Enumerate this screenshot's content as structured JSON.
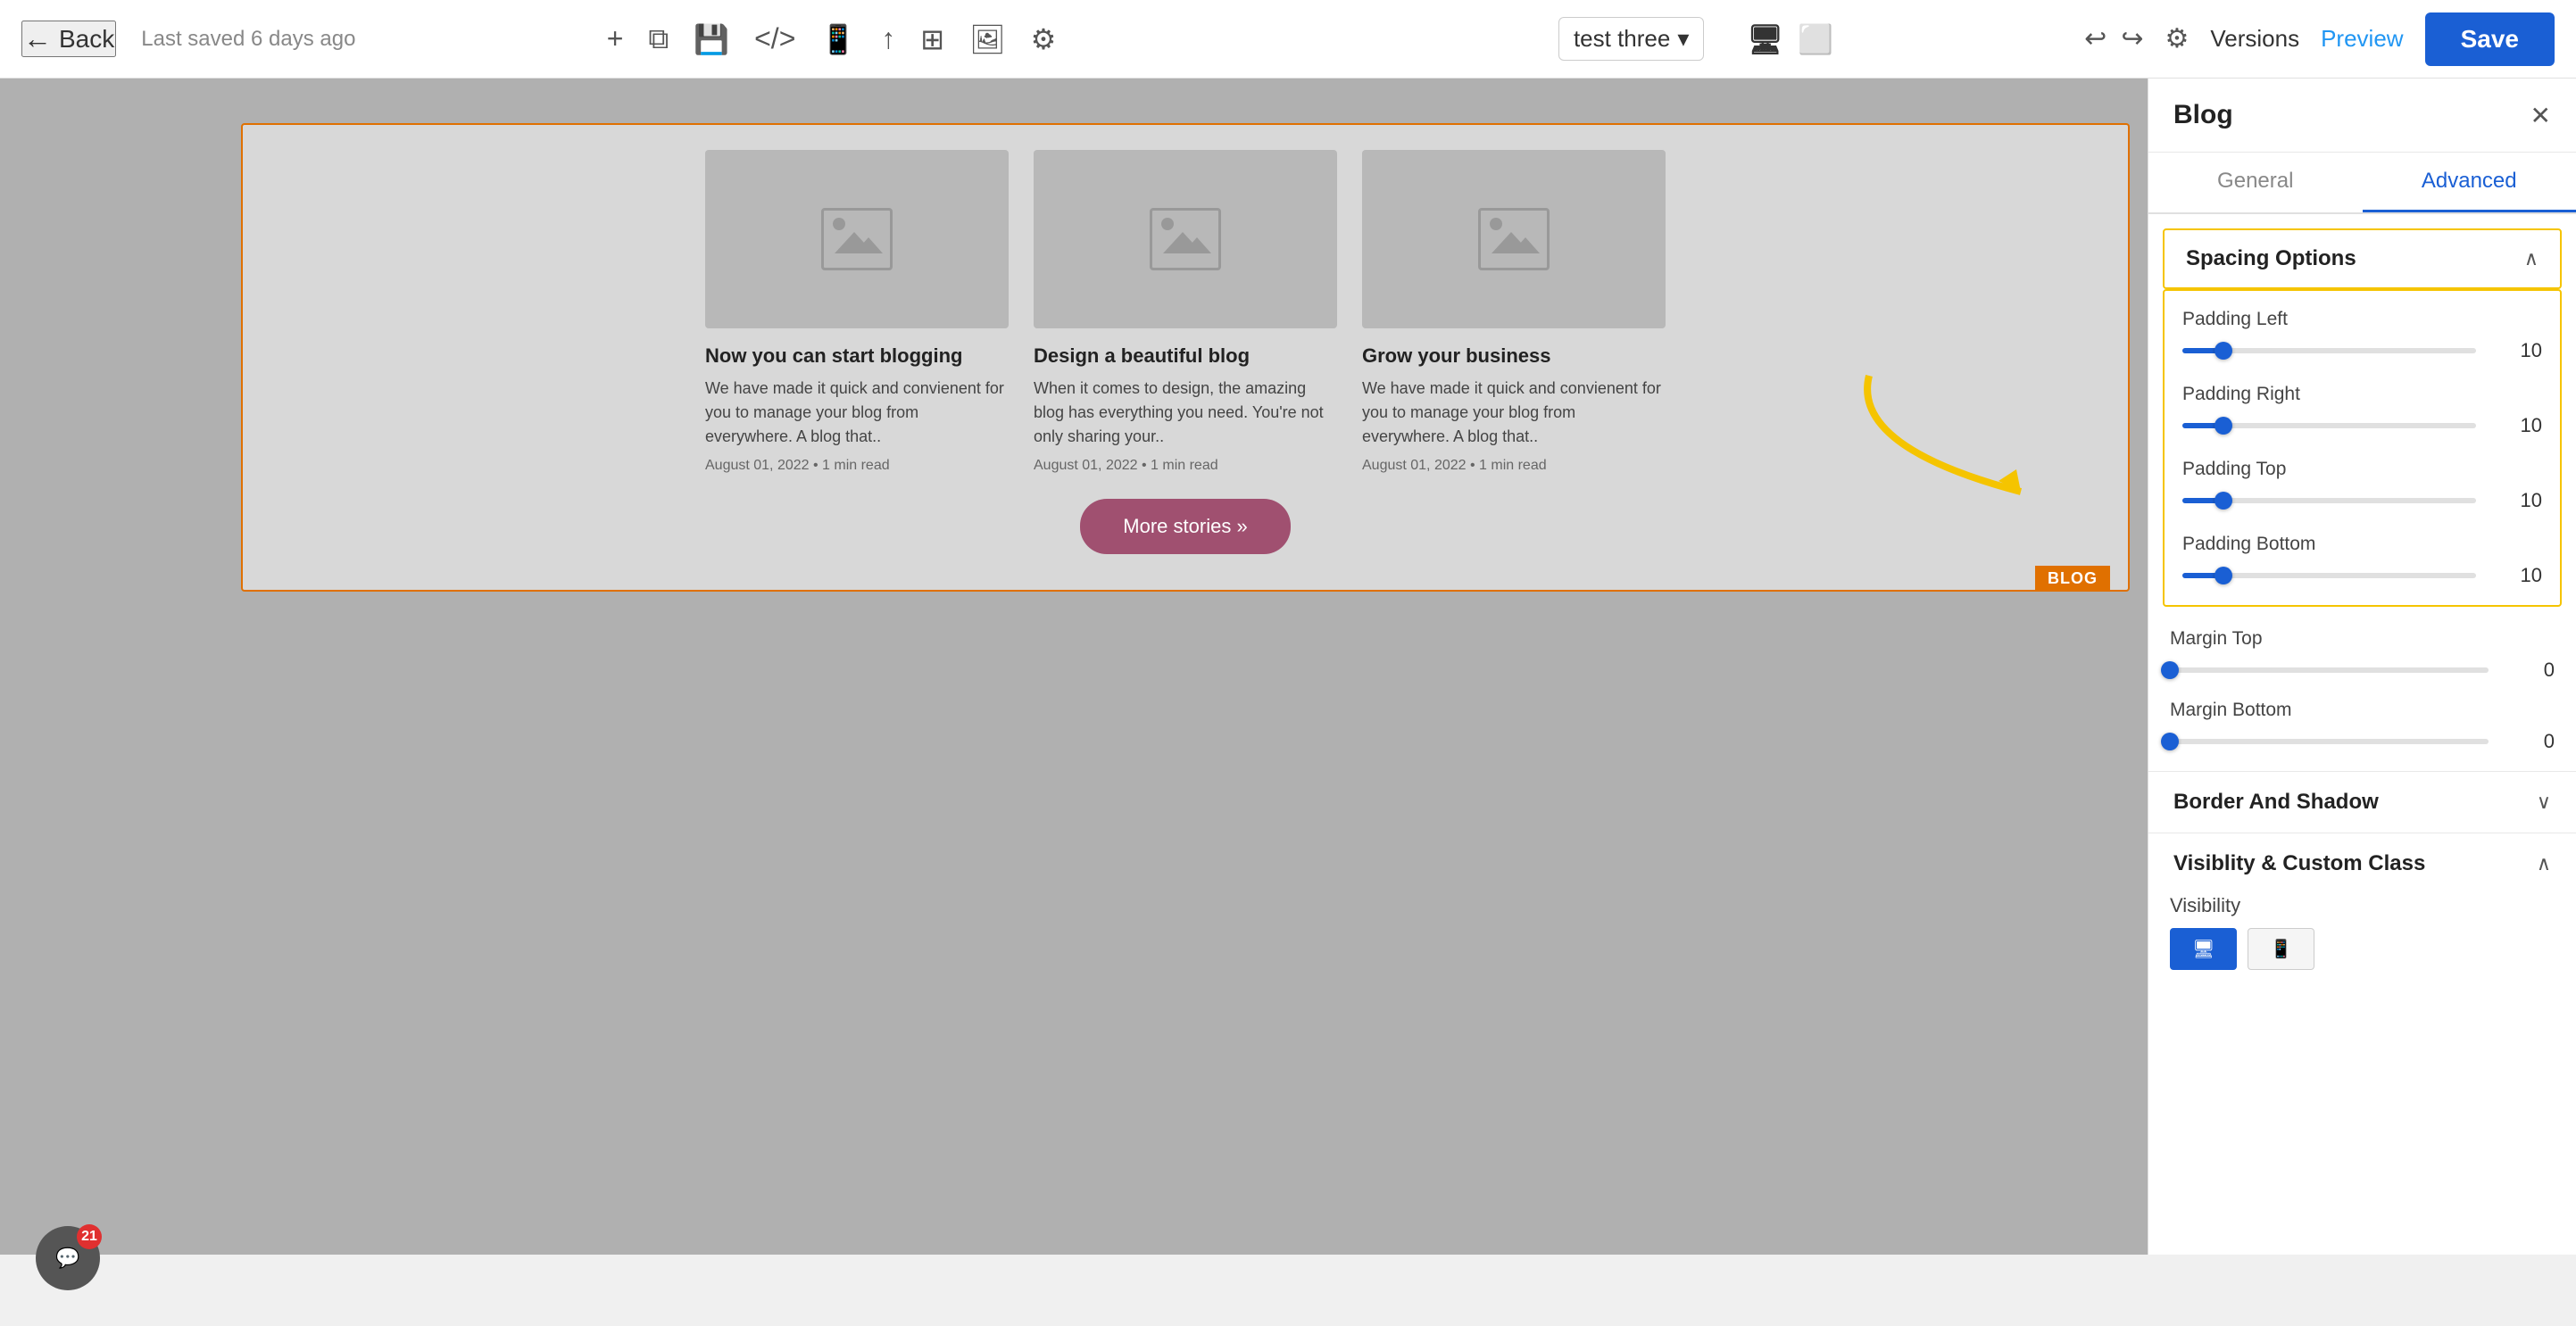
{
  "toolbar": {
    "back_label": "Back",
    "saved_text": "Last saved 6 days ago",
    "site_name": "test three",
    "versions_label": "Versions",
    "preview_label": "Preview",
    "save_label": "Save"
  },
  "blog_widget": {
    "tag": "BLOG",
    "card1": {
      "title": "Now you can start blogging",
      "desc": "We have made it quick and convienent for you to manage your blog from everywhere. A blog that..",
      "meta": "August 01, 2022 • 1 min read"
    },
    "card2": {
      "title": "Design a beautiful blog",
      "desc": "When it comes to design, the amazing blog has everything you need. You're not only sharing your..",
      "meta": "August 01, 2022 • 1 min read"
    },
    "card3": {
      "title": "Grow your business",
      "desc": "We have made it quick and convienent for you to manage your blog from everywhere. A blog that..",
      "meta": "August 01, 2022 • 1 min read"
    },
    "more_button": "More stories »"
  },
  "right_panel": {
    "title": "Blog",
    "tab_general": "General",
    "tab_advanced": "Advanced",
    "spacing_options": {
      "label": "Spacing Options",
      "padding_left": {
        "label": "Padding Left",
        "value": 10,
        "percent": 14
      },
      "padding_right": {
        "label": "Padding Right",
        "value": 10,
        "percent": 14
      },
      "padding_top": {
        "label": "Padding Top",
        "value": 10,
        "percent": 14
      },
      "padding_bottom": {
        "label": "Padding Bottom",
        "value": 10,
        "percent": 14
      }
    },
    "margin_top": {
      "label": "Margin Top",
      "value": 0,
      "percent": 0
    },
    "margin_bottom": {
      "label": "Margin Bottom",
      "value": 0,
      "percent": 0
    },
    "border_shadow": {
      "label": "Border And Shadow"
    },
    "visibility_section": {
      "label": "Visiblity & Custom Class",
      "visibility_label": "Visibility"
    }
  },
  "notification": {
    "count": "21"
  },
  "icons": {
    "plus": "+",
    "layers": "⧉",
    "save_icon": "💾",
    "code": "</>",
    "mobile": "📱",
    "export": "↑",
    "grid": "⊞",
    "media": "🖼",
    "settings": "⚙",
    "undo": "↩",
    "redo": "↪",
    "settings2": "⚙",
    "desktop": "🖥",
    "tablet": "⬜"
  }
}
